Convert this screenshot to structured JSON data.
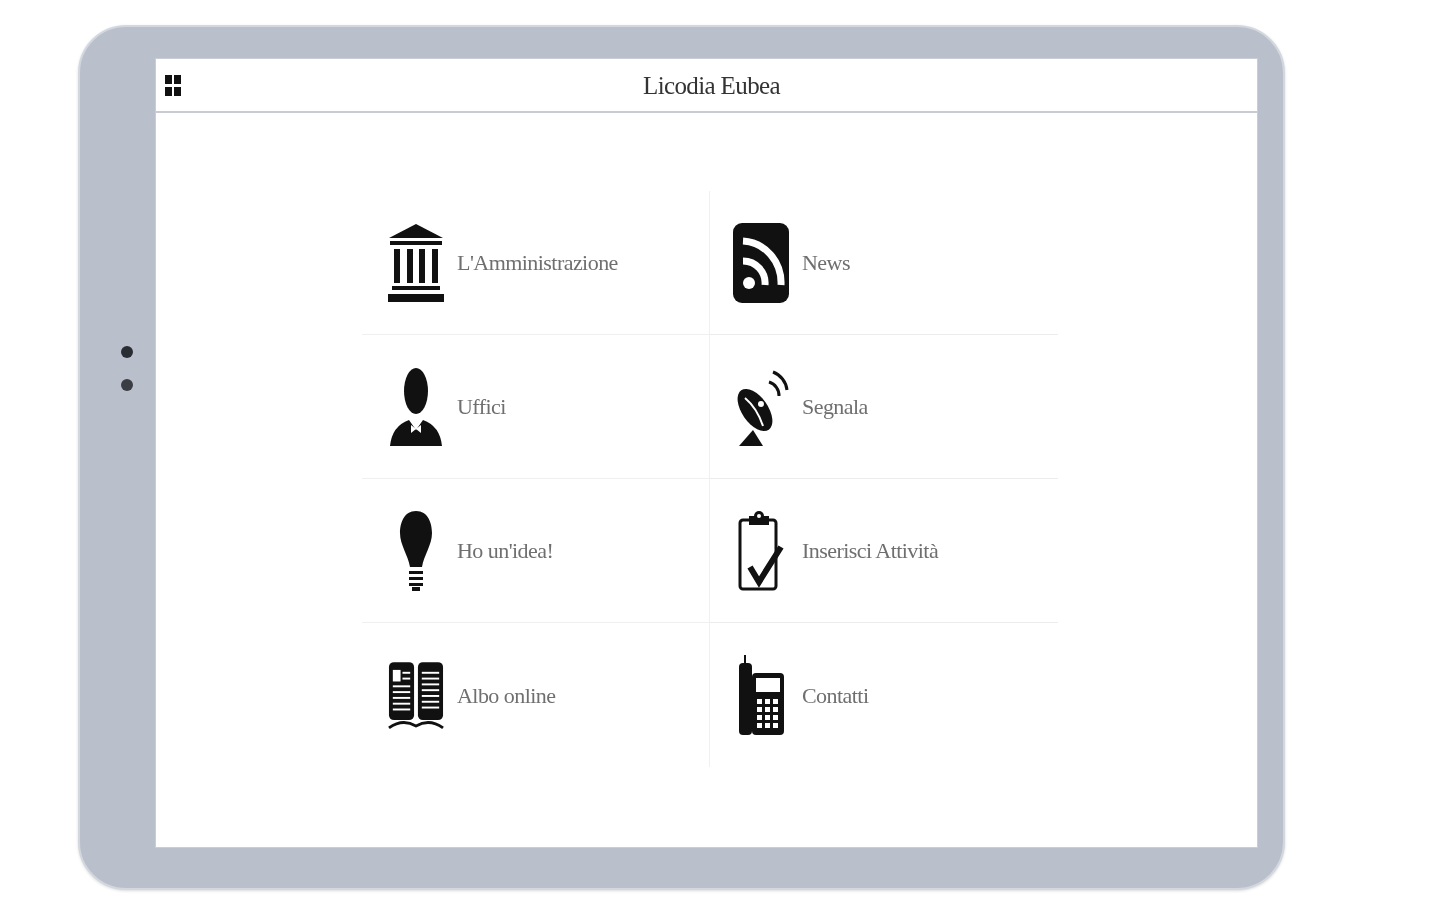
{
  "app_bar": {
    "title": "Licodia Eubea"
  },
  "menu": [
    {
      "label": "L'Amministrazione"
    },
    {
      "label": "News"
    },
    {
      "label": "Uffici"
    },
    {
      "label": "Segnala"
    },
    {
      "label": "Ho un'idea!"
    },
    {
      "label": "Inserisci Attività"
    },
    {
      "label": "Albo online"
    },
    {
      "label": "Contatti"
    }
  ]
}
